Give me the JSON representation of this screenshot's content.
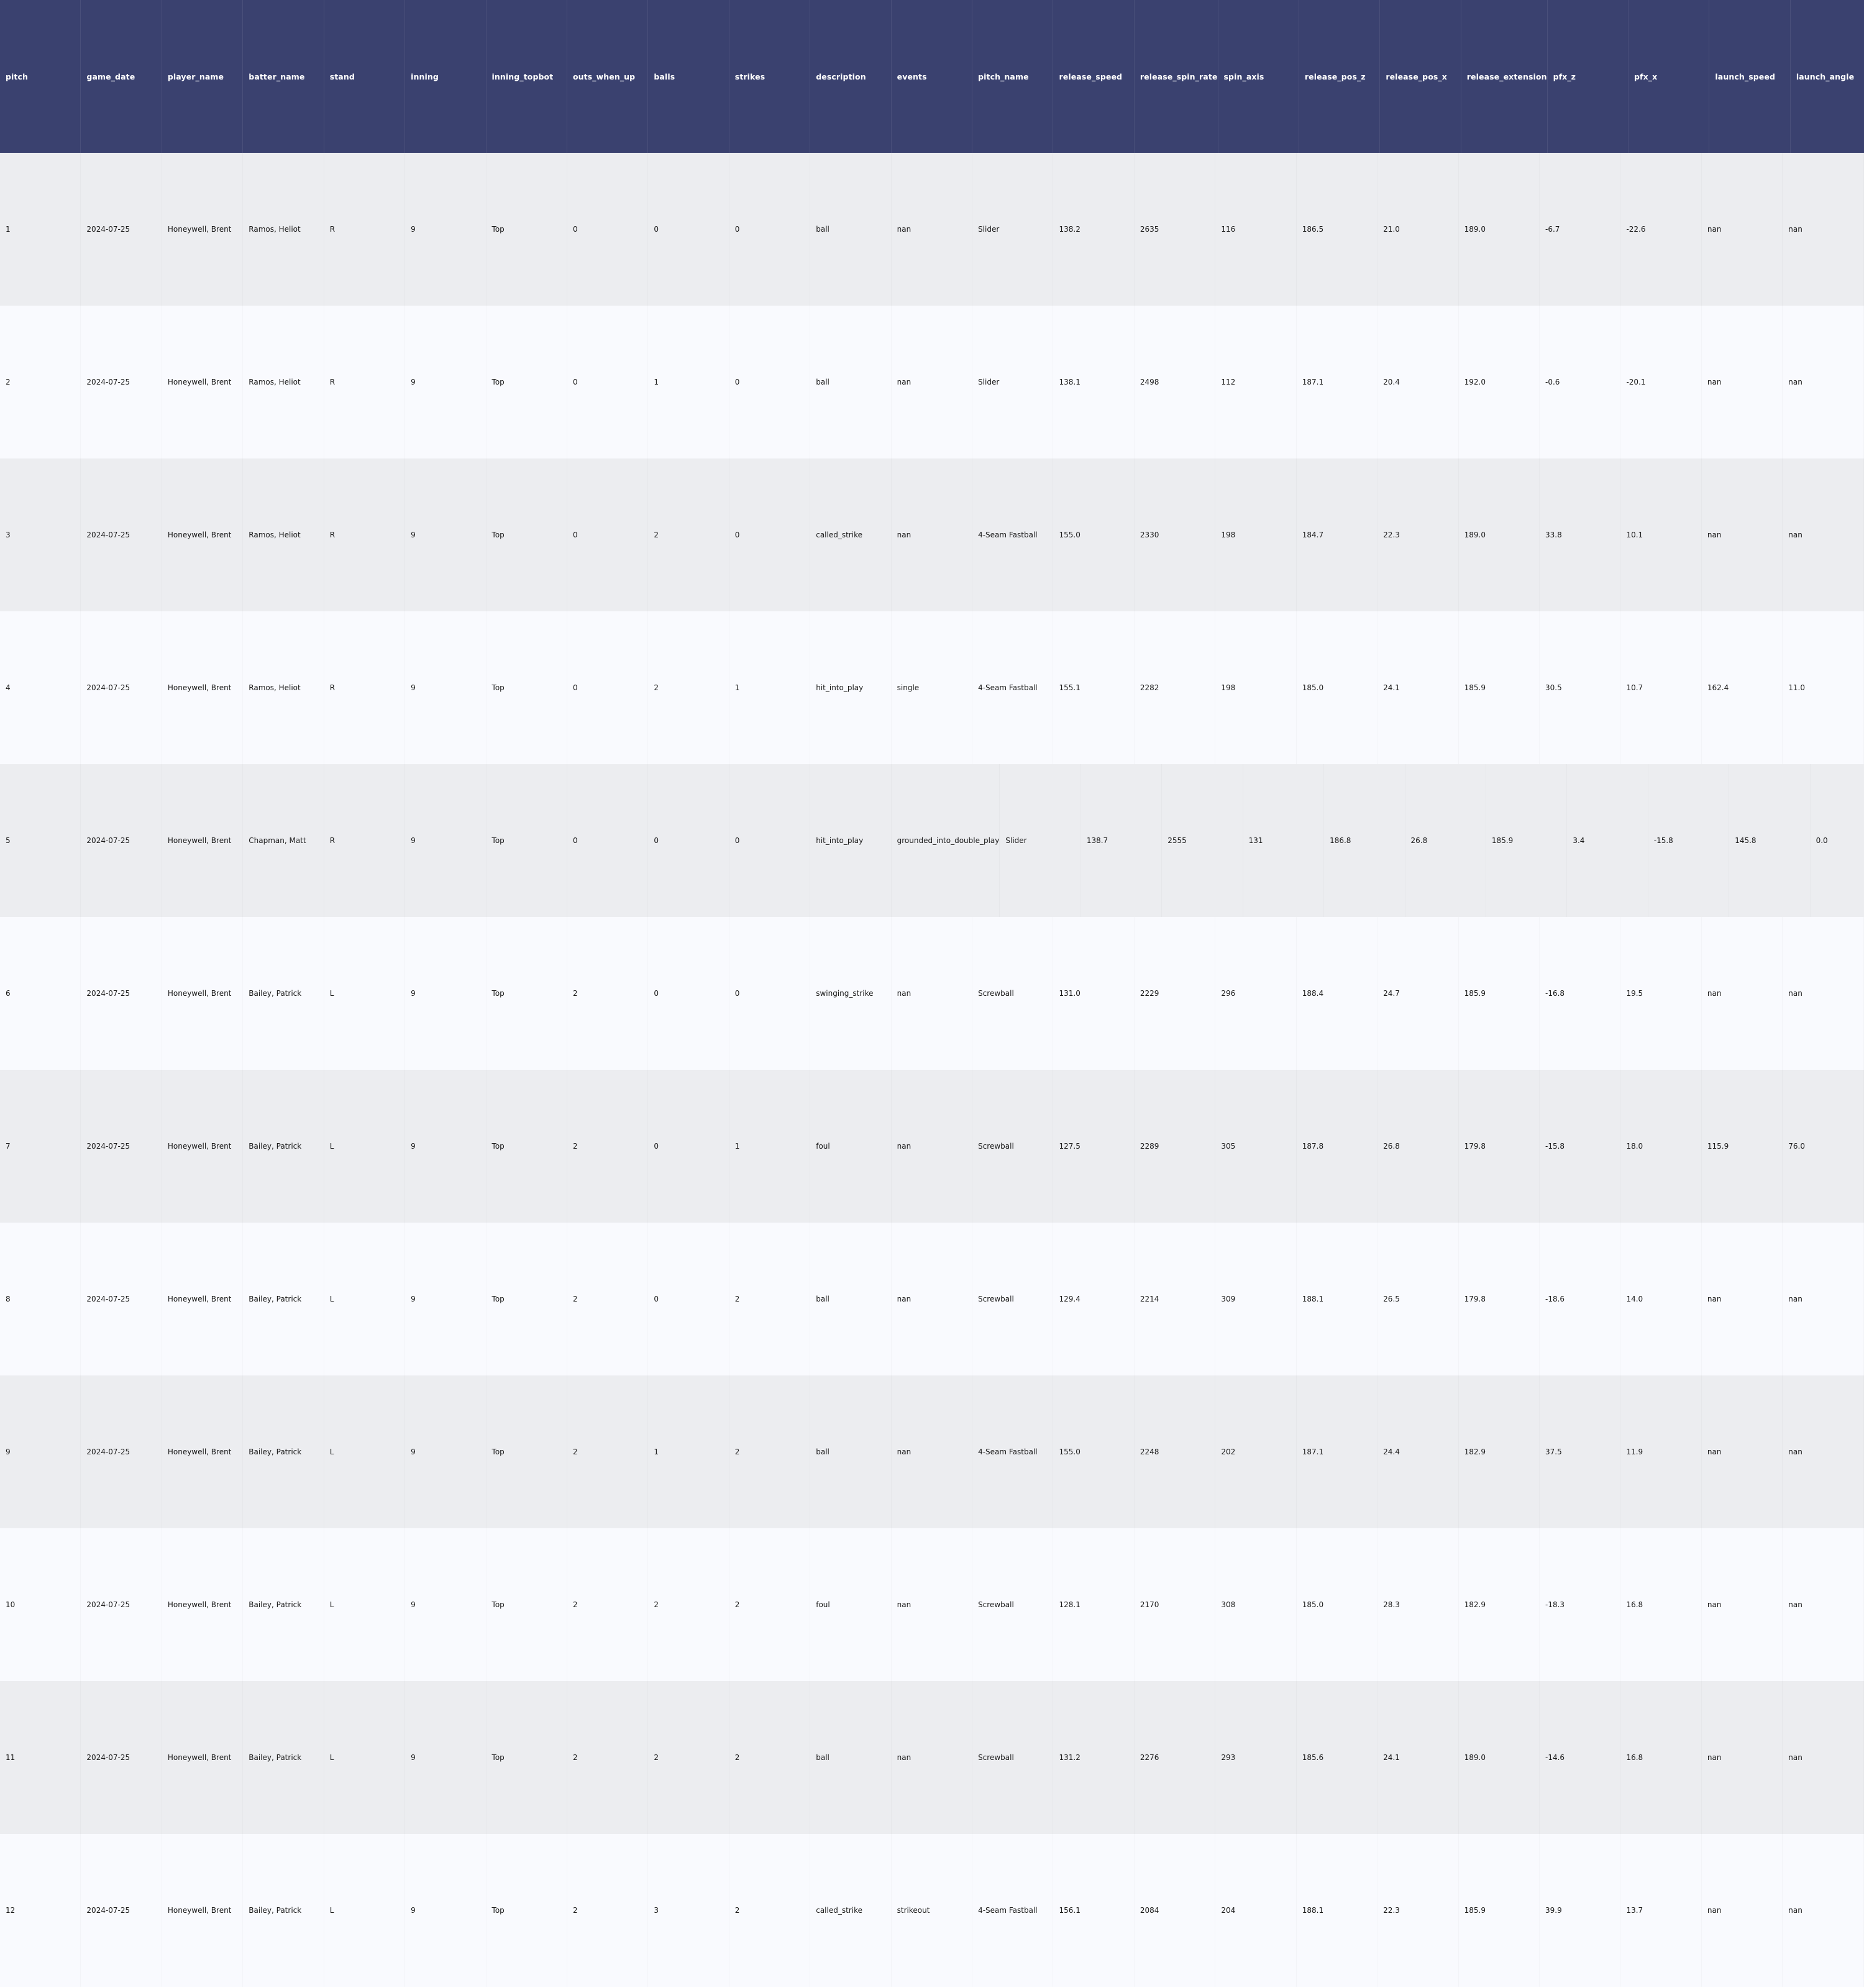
{
  "chart_data": {
    "type": "table",
    "columns": [
      "pitch",
      "game_date",
      "player_name",
      "batter_name",
      "stand",
      "inning",
      "inning_topbot",
      "outs_when_up",
      "balls",
      "strikes",
      "description",
      "events",
      "pitch_name",
      "release_speed",
      "release_spin_rate",
      "spin_axis",
      "release_pos_z",
      "release_pos_x",
      "release_extension",
      "pfx_z",
      "pfx_x",
      "launch_speed",
      "launch_angle"
    ],
    "rows": [
      [
        "1",
        "2024-07-25",
        "Honeywell, Brent",
        "Ramos, Heliot",
        "R",
        "9",
        "Top",
        "0",
        "0",
        "0",
        "ball",
        "nan",
        "Slider",
        "138.2",
        "2635",
        "116",
        "186.5",
        "21.0",
        "189.0",
        "-6.7",
        "-22.6",
        "nan",
        "nan"
      ],
      [
        "2",
        "2024-07-25",
        "Honeywell, Brent",
        "Ramos, Heliot",
        "R",
        "9",
        "Top",
        "0",
        "1",
        "0",
        "ball",
        "nan",
        "Slider",
        "138.1",
        "2498",
        "112",
        "187.1",
        "20.4",
        "192.0",
        "-0.6",
        "-20.1",
        "nan",
        "nan"
      ],
      [
        "3",
        "2024-07-25",
        "Honeywell, Brent",
        "Ramos, Heliot",
        "R",
        "9",
        "Top",
        "0",
        "2",
        "0",
        "called_strike",
        "nan",
        "4-Seam Fastball",
        "155.0",
        "2330",
        "198",
        "184.7",
        "22.3",
        "189.0",
        "33.8",
        "10.1",
        "nan",
        "nan"
      ],
      [
        "4",
        "2024-07-25",
        "Honeywell, Brent",
        "Ramos, Heliot",
        "R",
        "9",
        "Top",
        "0",
        "2",
        "1",
        "hit_into_play",
        "single",
        "4-Seam Fastball",
        "155.1",
        "2282",
        "198",
        "185.0",
        "24.1",
        "185.9",
        "30.5",
        "10.7",
        "162.4",
        "11.0"
      ],
      [
        "5",
        "2024-07-25",
        "Honeywell, Brent",
        "Chapman, Matt",
        "R",
        "9",
        "Top",
        "0",
        "0",
        "0",
        "hit_into_play",
        "grounded_into_double_play",
        "Slider",
        "138.7",
        "2555",
        "131",
        "186.8",
        "26.8",
        "185.9",
        "3.4",
        "-15.8",
        "145.8",
        "0.0"
      ],
      [
        "6",
        "2024-07-25",
        "Honeywell, Brent",
        "Bailey, Patrick",
        "L",
        "9",
        "Top",
        "2",
        "0",
        "0",
        "swinging_strike",
        "nan",
        "Screwball",
        "131.0",
        "2229",
        "296",
        "188.4",
        "24.7",
        "185.9",
        "-16.8",
        "19.5",
        "nan",
        "nan"
      ],
      [
        "7",
        "2024-07-25",
        "Honeywell, Brent",
        "Bailey, Patrick",
        "L",
        "9",
        "Top",
        "2",
        "0",
        "1",
        "foul",
        "nan",
        "Screwball",
        "127.5",
        "2289",
        "305",
        "187.8",
        "26.8",
        "179.8",
        "-15.8",
        "18.0",
        "115.9",
        "76.0"
      ],
      [
        "8",
        "2024-07-25",
        "Honeywell, Brent",
        "Bailey, Patrick",
        "L",
        "9",
        "Top",
        "2",
        "0",
        "2",
        "ball",
        "nan",
        "Screwball",
        "129.4",
        "2214",
        "309",
        "188.1",
        "26.5",
        "179.8",
        "-18.6",
        "14.0",
        "nan",
        "nan"
      ],
      [
        "9",
        "2024-07-25",
        "Honeywell, Brent",
        "Bailey, Patrick",
        "L",
        "9",
        "Top",
        "2",
        "1",
        "2",
        "ball",
        "nan",
        "4-Seam Fastball",
        "155.0",
        "2248",
        "202",
        "187.1",
        "24.4",
        "182.9",
        "37.5",
        "11.9",
        "nan",
        "nan"
      ],
      [
        "10",
        "2024-07-25",
        "Honeywell, Brent",
        "Bailey, Patrick",
        "L",
        "9",
        "Top",
        "2",
        "2",
        "2",
        "foul",
        "nan",
        "Screwball",
        "128.1",
        "2170",
        "308",
        "185.0",
        "28.3",
        "182.9",
        "-18.3",
        "16.8",
        "nan",
        "nan"
      ],
      [
        "11",
        "2024-07-25",
        "Honeywell, Brent",
        "Bailey, Patrick",
        "L",
        "9",
        "Top",
        "2",
        "2",
        "2",
        "ball",
        "nan",
        "Screwball",
        "131.2",
        "2276",
        "293",
        "185.6",
        "24.1",
        "189.0",
        "-14.6",
        "16.8",
        "nan",
        "nan"
      ],
      [
        "12",
        "2024-07-25",
        "Honeywell, Brent",
        "Bailey, Patrick",
        "L",
        "9",
        "Top",
        "2",
        "3",
        "2",
        "called_strike",
        "strikeout",
        "4-Seam Fastball",
        "156.1",
        "2084",
        "204",
        "188.1",
        "22.3",
        "185.9",
        "39.9",
        "13.7",
        "nan",
        "nan"
      ]
    ]
  },
  "colors": {
    "header_bg": "#3a416f",
    "header_text": "#ffffff",
    "row_even_bg": "#ecedf0",
    "row_odd_bg": "#f9fafe",
    "cell_text": "#1a1a1a"
  }
}
